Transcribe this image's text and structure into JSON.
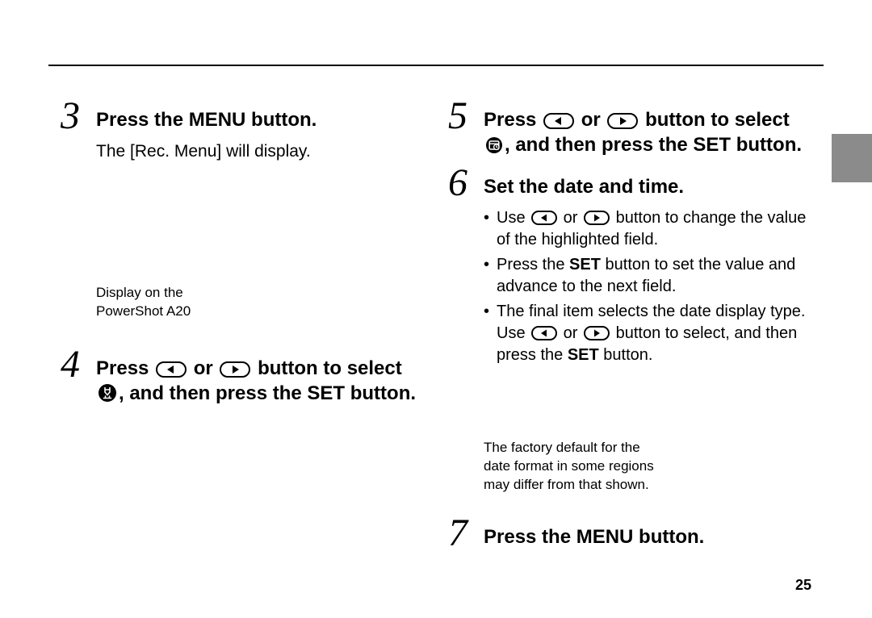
{
  "page_number": "25",
  "left": {
    "step3": {
      "num": "3",
      "title": "Press the MENU button.",
      "body": "The [Rec. Menu] will display.",
      "caption": "Display on the\nPowerShot A20"
    },
    "step4": {
      "num": "4",
      "title_pre": "Press ",
      "title_or": " or ",
      "title_mid": " button to select ",
      "title_post": ", and then press the SET button."
    }
  },
  "right": {
    "step5": {
      "num": "5",
      "title_pre": "Press ",
      "title_or": " or ",
      "title_mid": " button to select ",
      "title_post": ", and then press the SET button."
    },
    "step6": {
      "num": "6",
      "title": "Set the date and time.",
      "b1_pre": "Use ",
      "b1_or": " or ",
      "b1_post": " button to change the value of the highlighted field.",
      "b2_pre": "Press the ",
      "b2_set": "SET",
      "b2_post": " button to set the value and advance to the next field.",
      "b3_pre": "The final item selects the date display type. Use ",
      "b3_or": " or ",
      "b3_mid": " button to select, and then press the ",
      "b3_set": "SET",
      "b3_post": " button.",
      "note": "The factory default for the date format in some regions may differ from that shown."
    },
    "step7": {
      "num": "7",
      "title": "Press the MENU button."
    }
  }
}
